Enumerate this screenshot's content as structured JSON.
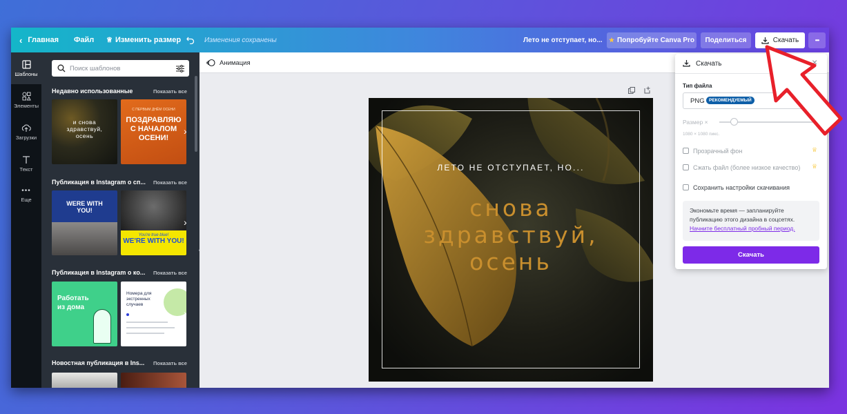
{
  "topbar": {
    "home": "Главная",
    "file": "Файл",
    "resize": "Изменить размер",
    "saved_status": "Изменения сохранены",
    "doc_title": "Лето не отступает, но...",
    "try_pro": "Попробуйте Canva Pro",
    "share": "Поделиться",
    "download": "Скачать",
    "more": "•••"
  },
  "rail": {
    "items": [
      {
        "label": "Шаблоны",
        "icon": "templates-icon"
      },
      {
        "label": "Элементы",
        "icon": "elements-icon"
      },
      {
        "label": "Загрузки",
        "icon": "upload-icon"
      },
      {
        "label": "Текст",
        "icon": "text-icon"
      },
      {
        "label": "Еще",
        "icon": "more-dots-icon"
      }
    ]
  },
  "panel": {
    "search_placeholder": "Поиск шаблонов",
    "sections": [
      {
        "title": "Недавно использованные",
        "see_all": "Показать все"
      },
      {
        "title": "Публикация в Instagram о сп...",
        "see_all": "Показать все"
      },
      {
        "title": "Публикация в Instagram о ко...",
        "see_all": "Показать все"
      },
      {
        "title": "Новостная публикация в Ins...",
        "see_all": "Показать все"
      }
    ],
    "thumbs": {
      "t1": {
        "line1": "и снова",
        "line2": "здравствуй,",
        "line3": "осень"
      },
      "t2": {
        "small": "С ПЕРВЫМ ДНЁМ ОСЕНИ",
        "line1": "ПОЗДРАВЛЯЮ",
        "line2": "С НАЧАЛОМ",
        "line3": "ОСЕНИ!"
      },
      "t3": {
        "line1": "WERE WITH",
        "line2": "YOU!"
      },
      "t4": {
        "script": "You're true blue!",
        "bold": "WE'RE WITH YOU!"
      },
      "t5": {
        "line1": "Работать",
        "line2": "из дома"
      },
      "t6": {
        "line1": "Номера для",
        "line2": "экстренных",
        "line3": "случаев"
      }
    }
  },
  "toolbar": {
    "animation": "Анимация"
  },
  "design": {
    "subtitle": "ЛЕТО НЕ ОТСТУПАЕТ, НО...",
    "line1": "снова",
    "line2": "здравствуй,",
    "line3": "осень"
  },
  "download_panel": {
    "title": "Скачать",
    "file_type_label": "Тип файла",
    "file_type_value": "PNG",
    "recommended_badge": "РЕКОМЕНДУЕМЫЙ",
    "size_label": "Размер ×",
    "size_value": "1080 × 1080 пикс.",
    "transparent_bg": "Прозрачный фон",
    "compress": "Сжать файл (более низкое качество)",
    "save_settings": "Сохранить настройки скачивания",
    "promo_text": "Экономьте время — запланируйте публикацию этого дизайна в соцсетях.",
    "promo_link": "Начните бесплатный пробный период.",
    "download_button": "Скачать"
  },
  "colors": {
    "accent_purple": "#7d2ae8",
    "design_gold": "#c98f2e",
    "annotation_red": "#e8202a"
  }
}
